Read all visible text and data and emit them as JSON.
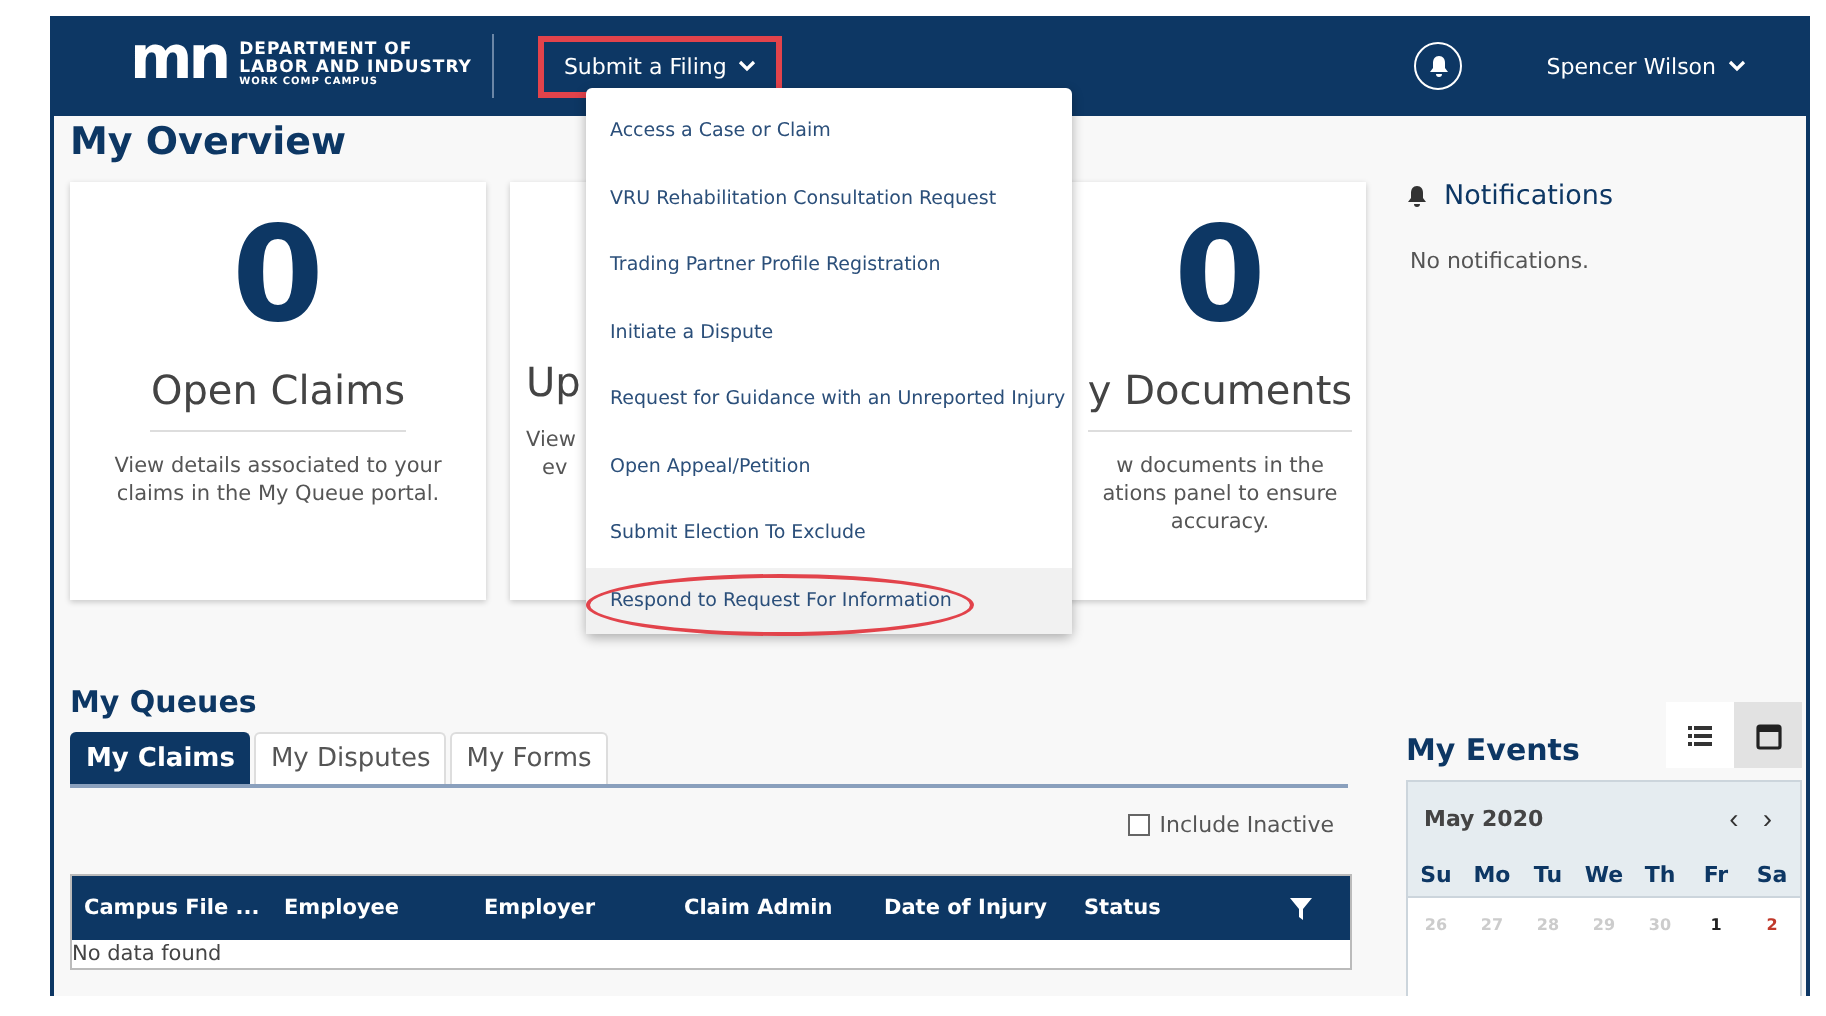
{
  "header": {
    "logo_mark": "mn",
    "logo_line_1": "DEPARTMENT OF",
    "logo_line_2": "LABOR AND INDUSTRY",
    "logo_line_3": "WORK COMP CAMPUS",
    "filing_button": {
      "label": "Submit a Filing",
      "outlined": true,
      "expanded": true
    },
    "user_name": "Spencer Wilson"
  },
  "filing_menu": [
    {
      "label": "Access a Case or Claim",
      "selected": false,
      "circled": false
    },
    {
      "label": "VRU Rehabilitation Consultation Request",
      "selected": false,
      "circled": false
    },
    {
      "label": "Trading Partner Profile Registration",
      "selected": false,
      "circled": false
    },
    {
      "label": "Initiate a Dispute",
      "selected": false,
      "circled": false
    },
    {
      "label": "Request for Guidance with an Unreported Injury",
      "selected": false,
      "circled": false
    },
    {
      "label": "Open Appeal/Petition",
      "selected": false,
      "circled": false
    },
    {
      "label": "Submit Election To Exclude",
      "selected": false,
      "circled": false
    },
    {
      "label": "Respond to Request For Information",
      "selected": true,
      "circled": true
    }
  ],
  "overview": {
    "title": "My Overview",
    "cards": [
      {
        "kind": "full",
        "count": "0",
        "title": "Open Claims",
        "description": [
          "View details associated to your",
          "claims in the My Queue portal."
        ]
      },
      {
        "kind": "left_part",
        "title": "Up",
        "description": [
          "View",
          "ev"
        ]
      },
      {
        "kind": "right_part",
        "count": "0",
        "title": "y Documents",
        "description": [
          "w documents in the",
          "ations panel to ensure",
          "accuracy."
        ]
      }
    ]
  },
  "notifications": {
    "title": "Notifications",
    "message": "No notifications."
  },
  "queues": {
    "title": "My Queues",
    "tabs": [
      {
        "label": "My Claims",
        "selected": true
      },
      {
        "label": "My Disputes",
        "selected": false
      },
      {
        "label": "My Forms",
        "selected": false
      }
    ],
    "include_inactive": {
      "label": "Include Inactive",
      "checked": false
    },
    "table": {
      "columns": [
        "Campus File ...",
        "Employee",
        "Employer",
        "Claim Admin",
        "Date of Injury",
        "Status"
      ],
      "empty_message": "No data found"
    }
  },
  "events": {
    "title": "My Events",
    "views": [
      {
        "kind": "list",
        "selected": false
      },
      {
        "kind": "calendar",
        "selected": true
      }
    ],
    "calendar": {
      "month": "May 2020",
      "prev": "‹",
      "next": "›",
      "weekdays": [
        "Su",
        "Mo",
        "Tu",
        "We",
        "Th",
        "Fr",
        "Sa"
      ],
      "days": [
        {
          "label": "26",
          "kind": "other_month"
        },
        {
          "label": "27",
          "kind": "other_month"
        },
        {
          "label": "28",
          "kind": "other_month"
        },
        {
          "label": "29",
          "kind": "other_month"
        },
        {
          "label": "30",
          "kind": "other_month"
        },
        {
          "label": "1",
          "kind": "weekday"
        },
        {
          "label": "2",
          "kind": "weekend"
        }
      ]
    }
  }
}
